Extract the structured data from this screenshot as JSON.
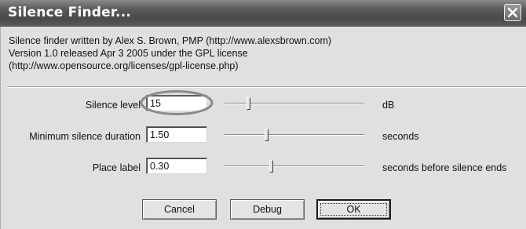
{
  "window": {
    "title": "Silence Finder..."
  },
  "intro": {
    "line1": "Silence finder written by Alex S. Brown, PMP (http://www.alexsbrown.com)",
    "line2": "Version 1.0 released Apr 3 2005 under the GPL license",
    "line3": "(http://www.opensource.org/licenses/gpl-license.php)"
  },
  "rows": [
    {
      "label": "Silence level",
      "value": "15",
      "unit": "dB",
      "slider_fraction": 0.17
    },
    {
      "label": "Minimum silence duration",
      "value": "1.50",
      "unit": "seconds",
      "slider_fraction": 0.3
    },
    {
      "label": "Place label",
      "value": "0.30",
      "unit": "seconds before silence ends",
      "slider_fraction": 0.33
    }
  ],
  "buttons": {
    "cancel": "Cancel",
    "debug": "Debug",
    "ok": "OK"
  },
  "icons": {
    "close": "close-icon"
  },
  "colors": {
    "highlight_ellipse": "#8a8a8a",
    "titlebar": "#4a4a4a"
  }
}
